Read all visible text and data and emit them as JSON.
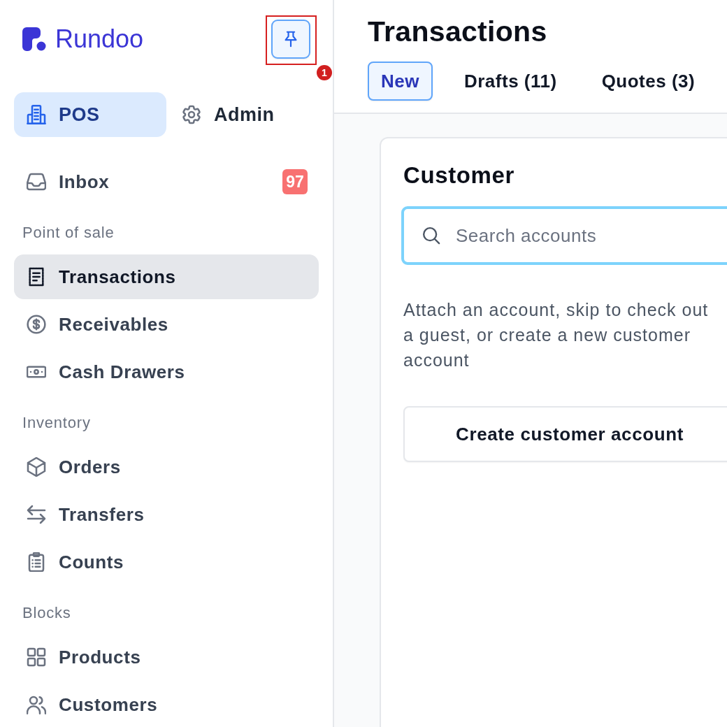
{
  "sidebar": {
    "logo": {
      "text": "Rundoo"
    },
    "pin_button": {
      "pinned": true
    },
    "modes": [
      {
        "label": "POS",
        "selected": true
      },
      {
        "label": "Admin",
        "selected": false
      }
    ],
    "items": [
      {
        "label": "Inbox",
        "badge": "97",
        "selected": false
      }
    ],
    "sections": [
      {
        "title": "Point of sale",
        "items": [
          {
            "label": "Transactions",
            "selected": true
          },
          {
            "label": "Receivables",
            "selected": false
          },
          {
            "label": "Cash Drawers",
            "selected": false
          }
        ]
      },
      {
        "title": "Inventory",
        "items": [
          {
            "label": "Orders",
            "selected": false
          },
          {
            "label": "Transfers",
            "selected": false
          },
          {
            "label": "Counts",
            "selected": false
          }
        ]
      },
      {
        "title": "Blocks",
        "items": [
          {
            "label": "Products",
            "selected": false
          },
          {
            "label": "Customers",
            "selected": false
          }
        ]
      }
    ]
  },
  "annotation": {
    "label": "1"
  },
  "page": {
    "title": "Transactions",
    "tabs": [
      {
        "label": "New",
        "selected": true
      },
      {
        "label": "Drafts (11)",
        "selected": false
      },
      {
        "label": "Quotes (3)",
        "selected": false
      }
    ]
  },
  "customer_card": {
    "title": "Customer",
    "search": {
      "placeholder": "Search accounts",
      "focused": true
    },
    "description": "Attach an account, skip to check out a guest, or create a new customer account",
    "button": "Create customer account"
  }
}
